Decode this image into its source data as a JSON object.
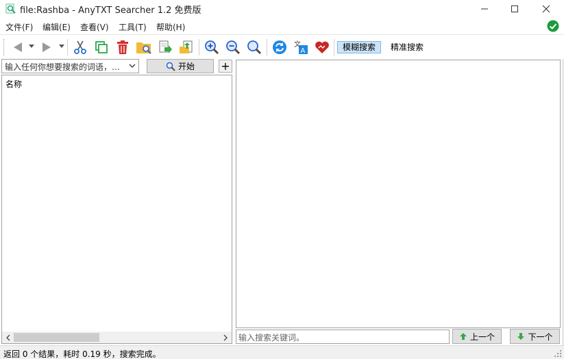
{
  "window": {
    "title": "file:Rashba - AnyTXT Searcher 1.2 免费版"
  },
  "menu": {
    "items": [
      "文件(F)",
      "编辑(E)",
      "查看(V)",
      "工具(T)",
      "帮助(H)"
    ]
  },
  "toolbar": {
    "fuzzy_label": "模糊搜索",
    "exact_label": "精准搜索",
    "icons": [
      "back-icon",
      "forward-icon",
      "cut-icon",
      "copy-icon",
      "delete-icon",
      "open-folder-icon",
      "export-icon",
      "import-icon",
      "zoom-in-icon",
      "zoom-out-icon",
      "zoom-reset-icon",
      "refresh-icon",
      "translate-icon",
      "heart-icon"
    ]
  },
  "search": {
    "placeholder": "输入任何你想要搜索的词语，…",
    "start_label": "开始",
    "plus_label": "+"
  },
  "results": {
    "column_name": "名称"
  },
  "find": {
    "placeholder": "输入搜索关键词。",
    "prev_label": "上一个",
    "next_label": "下一个"
  },
  "status": {
    "text": "返回 0 个结果，耗时 0.19 秒，搜索完成。"
  },
  "colors": {
    "accent": "#1e88e5",
    "ok": "#1a9c3c",
    "delete": "#d32f2f",
    "fuzzy_bg": "#cce4f7"
  }
}
